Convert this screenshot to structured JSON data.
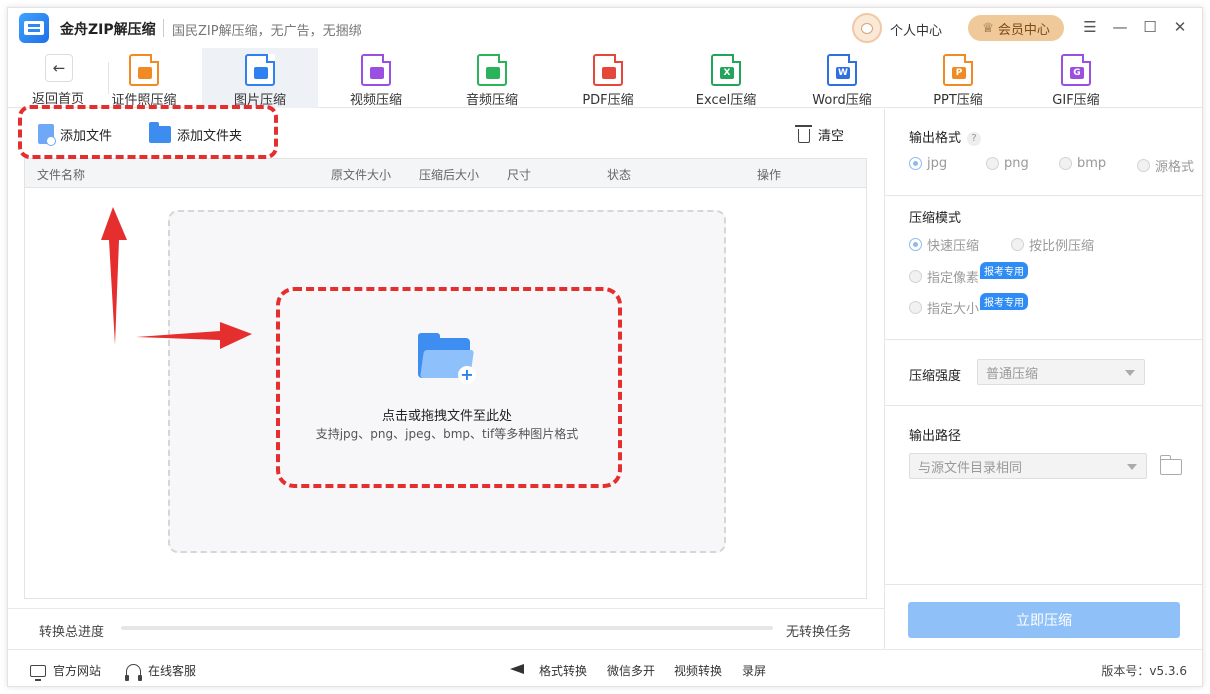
{
  "app": {
    "name": "金舟ZIP解压缩",
    "slogan": "国民ZIP解压缩，无广告，无捆绑",
    "user_center": "个人中心",
    "vip_center": "会员中心",
    "window_controls": [
      "menu-icon",
      "minimize-icon",
      "maximize-icon",
      "close-icon"
    ]
  },
  "toolbar": {
    "back_label": "返回首页",
    "tools": [
      {
        "label": "证件照压缩",
        "icon": "id-photo-icon",
        "color": "#f08a24",
        "glyph": "",
        "badge": "报考专用",
        "active": false
      },
      {
        "label": "图片压缩",
        "icon": "image-icon",
        "color": "#2f80f0",
        "glyph": "",
        "badge": "",
        "active": true
      },
      {
        "label": "视频压缩",
        "icon": "video-icon",
        "color": "#9b4fe0",
        "glyph": "",
        "badge": "",
        "active": false
      },
      {
        "label": "音频压缩",
        "icon": "audio-icon",
        "color": "#2ab35a",
        "glyph": "",
        "badge": "",
        "active": false
      },
      {
        "label": "PDF压缩",
        "icon": "pdf-icon",
        "color": "#e5483b",
        "glyph": "",
        "badge": "",
        "active": false
      },
      {
        "label": "Excel压缩",
        "icon": "excel-icon",
        "color": "#22a45a",
        "glyph": "X",
        "badge": "",
        "active": false
      },
      {
        "label": "Word压缩",
        "icon": "word-icon",
        "color": "#2f6fe0",
        "glyph": "W",
        "badge": "",
        "active": false
      },
      {
        "label": "PPT压缩",
        "icon": "ppt-icon",
        "color": "#f08a24",
        "glyph": "P",
        "badge": "",
        "active": false
      },
      {
        "label": "GIF压缩",
        "icon": "gif-icon",
        "color": "#9b4fe0",
        "glyph": "G",
        "badge": "",
        "active": false
      }
    ]
  },
  "actions": {
    "add_file": "添加文件",
    "add_folder": "添加文件夹",
    "clear": "清空"
  },
  "table": {
    "columns": [
      "文件名称",
      "原文件大小",
      "压缩后大小",
      "尺寸",
      "状态",
      "操作"
    ]
  },
  "dropzone": {
    "title": "点击或拖拽文件至此处",
    "subtitle": "支持jpg、png、jpeg、bmp、tif等多种图片格式"
  },
  "progress": {
    "label": "转换总进度",
    "value": 0,
    "status": "无转换任务"
  },
  "settings": {
    "output_format": {
      "title": "输出格式",
      "options": [
        "jpg",
        "png",
        "bmp",
        "源格式"
      ],
      "selected": "jpg"
    },
    "compress_mode": {
      "title": "压缩模式",
      "options": [
        "快速压缩",
        "按比例压缩",
        "指定像素",
        "指定大小"
      ],
      "badges": [
        "",
        "",
        "报考专用",
        "报考专用"
      ],
      "selected": "快速压缩"
    },
    "strength": {
      "title": "压缩强度",
      "value": "普通压缩"
    },
    "output_path": {
      "title": "输出路径",
      "value": "与源文件目录相同"
    },
    "start_button": "立即压缩"
  },
  "statusbar": {
    "official_site": "官方网站",
    "online_service": "在线客服",
    "links": [
      "格式转换",
      "微信多开",
      "视频转换",
      "录屏"
    ],
    "version": "版本号：v5.3.6"
  },
  "colors": {
    "accent": "#2f80f0",
    "annotation_red": "#e52e2e",
    "vip": "#f0c99a"
  }
}
